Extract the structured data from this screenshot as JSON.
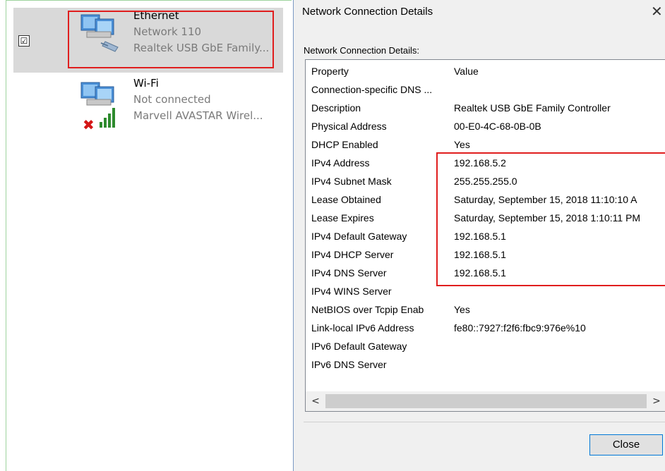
{
  "adapters": [
    {
      "name": "Ethernet",
      "network": "Network 110",
      "device": "Realtek USB GbE Family...",
      "checked": "☑"
    },
    {
      "name": "Wi-Fi",
      "network": "Not connected",
      "device": "Marvell AVASTAR Wirel..."
    }
  ],
  "dialog": {
    "title": "Network Connection Details",
    "close_glyph": "✕",
    "group_label": "Network Connection Details:",
    "header": {
      "property": "Property",
      "value": "Value"
    },
    "rows": [
      {
        "property": "Connection-specific DNS ...",
        "value": ""
      },
      {
        "property": "Description",
        "value": "Realtek USB GbE Family Controller"
      },
      {
        "property": "Physical Address",
        "value": "00-E0-4C-68-0B-0B"
      },
      {
        "property": "DHCP Enabled",
        "value": "Yes"
      },
      {
        "property": "IPv4 Address",
        "value": "192.168.5.2"
      },
      {
        "property": "IPv4 Subnet Mask",
        "value": "255.255.255.0"
      },
      {
        "property": "Lease Obtained",
        "value": "Saturday, September 15, 2018 11:10:10 A"
      },
      {
        "property": "Lease Expires",
        "value": "Saturday, September 15, 2018 1:10:11 PM"
      },
      {
        "property": "IPv4 Default Gateway",
        "value": "192.168.5.1"
      },
      {
        "property": "IPv4 DHCP Server",
        "value": "192.168.5.1"
      },
      {
        "property": "IPv4 DNS Server",
        "value": "192.168.5.1"
      },
      {
        "property": "IPv4 WINS Server",
        "value": ""
      },
      {
        "property": "NetBIOS over Tcpip Enab",
        "value": "Yes"
      },
      {
        "property": "Link-local IPv6 Address",
        "value": "fe80::7927:f2f6:fbc9:976e%10"
      },
      {
        "property": "IPv6 Default Gateway",
        "value": ""
      },
      {
        "property": "IPv6 DNS Server",
        "value": ""
      }
    ],
    "scroll_left": "<",
    "scroll_right": ">",
    "close_button": "Close"
  },
  "colors": {
    "highlight": "#e01e1e",
    "selected_bg": "#d9d9d9",
    "muted_text": "#7a7a7a"
  }
}
